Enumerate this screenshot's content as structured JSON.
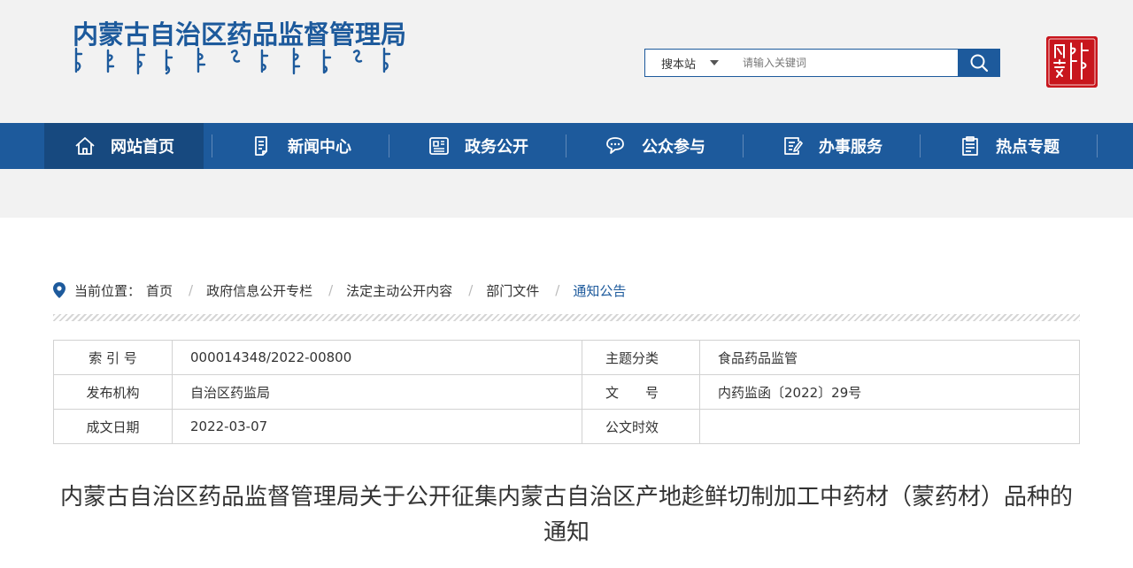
{
  "header": {
    "logo_text": "内蒙古自治区药品监督管理局",
    "search": {
      "scope_label": "搜本站",
      "placeholder": "请输入关键词"
    }
  },
  "nav": {
    "items": [
      {
        "label": "网站首页",
        "icon": "home-icon"
      },
      {
        "label": "新闻中心",
        "icon": "news-icon"
      },
      {
        "label": "政务公开",
        "icon": "newspaper-icon"
      },
      {
        "label": "公众参与",
        "icon": "chat-icon"
      },
      {
        "label": "办事服务",
        "icon": "form-icon"
      },
      {
        "label": "热点专题",
        "icon": "document-icon"
      }
    ]
  },
  "breadcrumb": {
    "label": "当前位置：",
    "items": [
      "首页",
      "政府信息公开专栏",
      "法定主动公开内容",
      "部门文件",
      "通知公告"
    ]
  },
  "info": {
    "index_label": "索 引 号",
    "index_value": "000014348/2022-00800",
    "topic_label": "主题分类",
    "topic_value": "食品药品监管",
    "publisher_label": "发布机构",
    "publisher_value": "自治区药监局",
    "doc_no_label": "文　　号",
    "doc_no_value": "内药监函〔2022〕29号",
    "date_label": "成文日期",
    "date_value": "2022-03-07",
    "validity_label": "公文时效",
    "validity_value": ""
  },
  "article": {
    "title": "内蒙古自治区药品监督管理局关于公开征集内蒙古自治区产地趁鲜切制加工中药材（蒙药材）品种的通知"
  },
  "colors": {
    "brand": "#1d5a9c",
    "nav_active": "#17497f",
    "seal_red": "#c8161d"
  }
}
